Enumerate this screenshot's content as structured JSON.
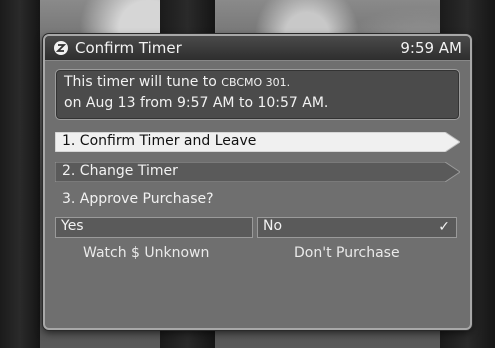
{
  "dialog": {
    "title": "Confirm Timer",
    "clock": "9:59 AM",
    "info": {
      "line1_prefix": "This timer will tune to",
      "channel": "CBCMO 301.",
      "line2": "on Aug 13 from 9:57 AM to 10:57 AM."
    },
    "options": [
      {
        "label": "1.  Confirm Timer and Leave"
      },
      {
        "label": "2.  Change Timer"
      }
    ],
    "question": "3. Approve Purchase?",
    "choices": {
      "yes": "Yes",
      "no": "No",
      "no_selected": true
    },
    "sublabels": {
      "yes": "Watch $ Unknown",
      "no": "Don't Purchase"
    }
  },
  "colors": {
    "highlight": "#f0f0f0",
    "panel": "#6f6f6f",
    "titlebar": "#333333"
  }
}
